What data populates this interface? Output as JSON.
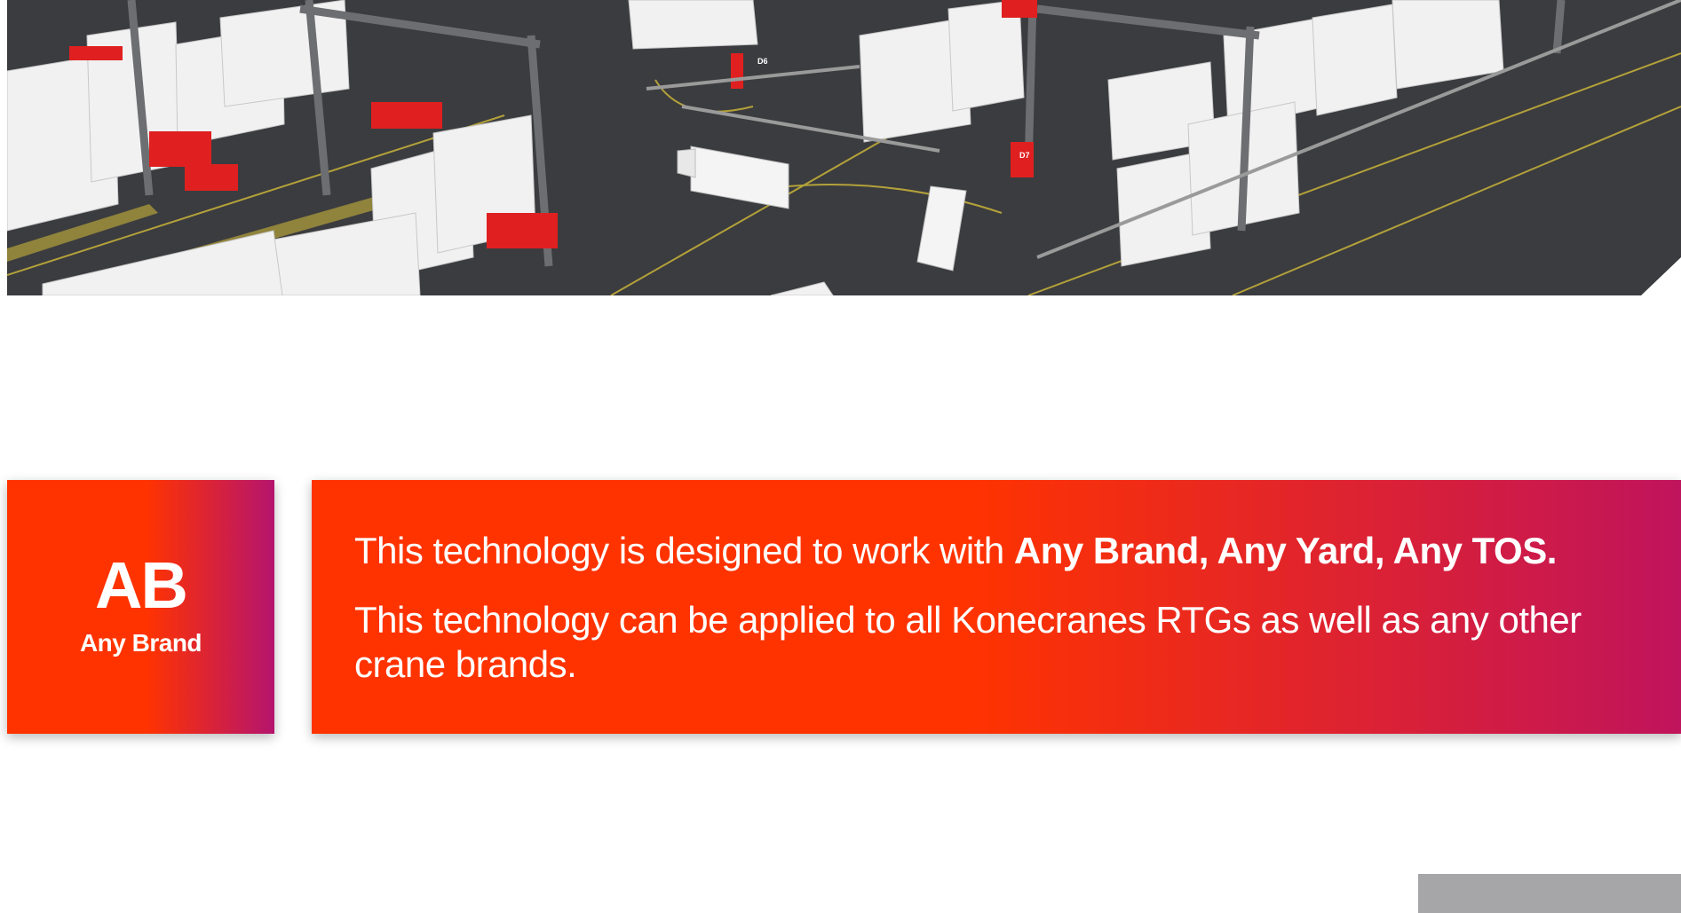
{
  "hero": {
    "block_labels": [
      "D6",
      "D7"
    ]
  },
  "feature_badge": {
    "abbreviation": "AB",
    "label": "Any Brand"
  },
  "info_panel": {
    "line1_prefix": "This technology is designed to work with ",
    "line1_emphasis": "Any Brand, Any Yard, Any TOS.",
    "line2": "This technology can be applied to all Konecranes RTGs as well as any other crane brands."
  },
  "colors": {
    "accent": "#ff3300",
    "accent_end": "#b5146e",
    "asphalt": "#3a3b3e",
    "container": "#f2f2f2",
    "crane_red": "#e02020",
    "tab_gray": "#a6a6a8"
  }
}
